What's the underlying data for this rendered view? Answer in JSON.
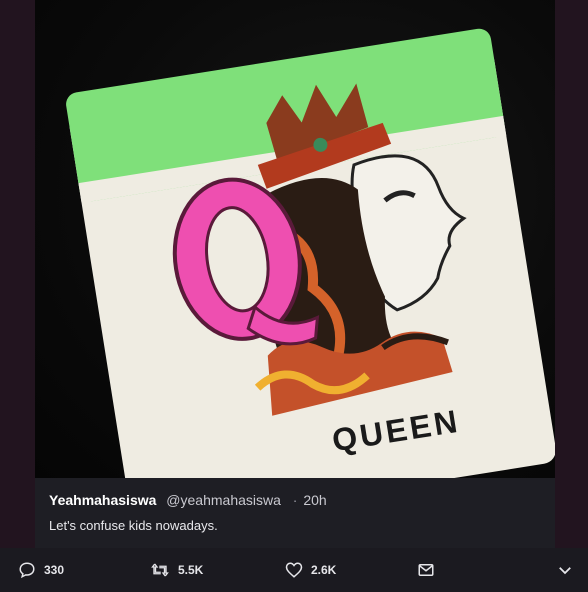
{
  "photo": {
    "tile_letter": "Q",
    "tile_caption": "QUEEN"
  },
  "tweet": {
    "display_name": "Yeahmahasiswa",
    "handle": "@yeahmahasiswa",
    "separator": "·",
    "time": "20h",
    "text": "Let's confuse kids nowadays."
  },
  "actions": {
    "reply_count": "330",
    "retweet_count": "5.5K",
    "like_count": "2.6K"
  },
  "icons": {
    "reply": "reply-icon",
    "retweet": "retweet-icon",
    "like": "heart-icon",
    "dm": "envelope-icon",
    "more": "chevron-down-icon"
  },
  "colors": {
    "background": "#22141f",
    "tile_top": "#7fe07a",
    "tile_body": "#efece2",
    "letter_pink": "#ee4fb0"
  }
}
